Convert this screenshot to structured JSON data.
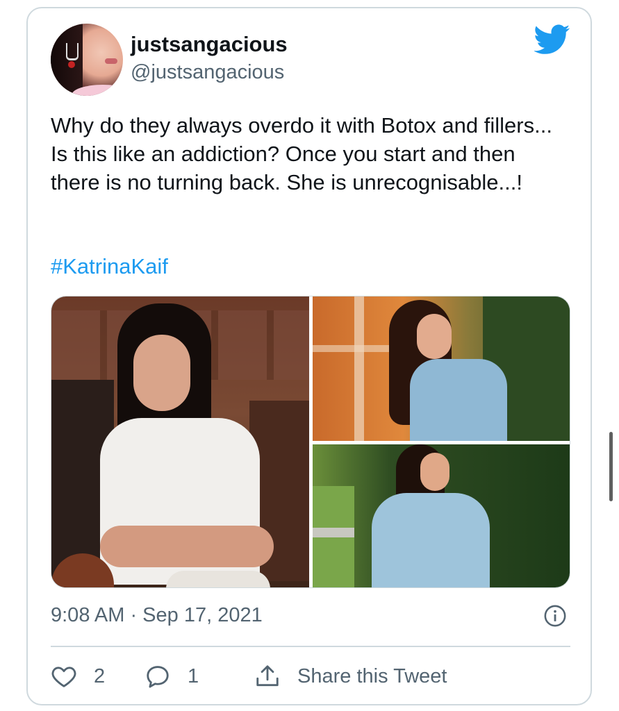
{
  "user": {
    "display_name": "justsangacious",
    "handle": "@justsangacious"
  },
  "tweet": {
    "text": "Why do they always overdo it with Botox and fillers... Is this like an addiction? Once you start and then there is no turning back. She is unrecognisable...!",
    "hashtag": "#KatrinaKaif",
    "timestamp": "9:08 AM · Sep 17, 2021"
  },
  "actions": {
    "like_count": "2",
    "reply_count": "1",
    "share_label": "Share this Tweet"
  },
  "icons": {
    "logo": "twitter-bird-icon",
    "info": "info-icon",
    "like": "heart-icon",
    "reply": "reply-icon",
    "share": "share-icon"
  },
  "colors": {
    "brand": "#1d9bf0",
    "text": "#0f1419",
    "muted": "#536471",
    "border": "#cfd9de"
  }
}
